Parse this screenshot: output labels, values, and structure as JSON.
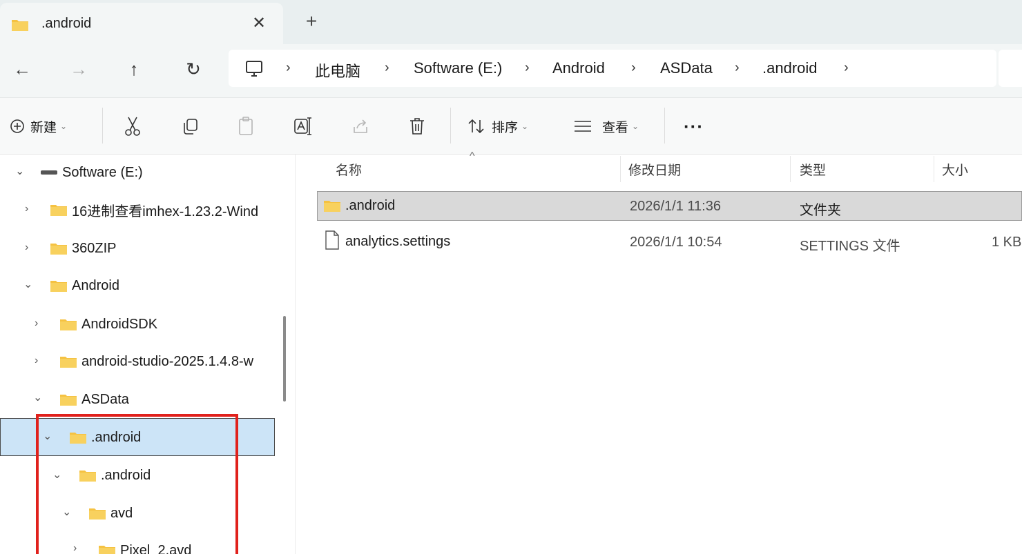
{
  "tab": {
    "title": ".android",
    "close": "✕",
    "new": "+"
  },
  "nav": {
    "back": "←",
    "forward": "→",
    "up": "↑",
    "refresh": "↻"
  },
  "breadcrumb": [
    "此电脑",
    "Software (E:)",
    "Android",
    "ASData",
    ".android"
  ],
  "breadcrumb_sep": "›",
  "toolbar": {
    "new_label": "新建",
    "sort_label": "排序",
    "view_label": "查看",
    "more": "···"
  },
  "sidebar": {
    "items": [
      {
        "label": "Software (E:)",
        "arrow": "⌄",
        "icon": "drive-icon"
      },
      {
        "label": "16进制查看imhex-1.23.2-Wind",
        "arrow": "›",
        "icon": "folder-icon"
      },
      {
        "label": "360ZIP",
        "arrow": "›",
        "icon": "folder-icon"
      },
      {
        "label": "Android",
        "arrow": "⌄",
        "icon": "folder-icon"
      },
      {
        "label": "AndroidSDK",
        "arrow": "›",
        "icon": "folder-icon"
      },
      {
        "label": "android-studio-2025.1.4.8-w",
        "arrow": "›",
        "icon": "folder-icon"
      },
      {
        "label": "ASData",
        "arrow": "⌄",
        "icon": "folder-icon"
      },
      {
        "label": ".android",
        "arrow": "⌄",
        "icon": "folder-icon",
        "selected": true
      },
      {
        "label": ".android",
        "arrow": "⌄",
        "icon": "folder-icon"
      },
      {
        "label": "avd",
        "arrow": "⌄",
        "icon": "folder-icon"
      },
      {
        "label": "Pixel_2.avd",
        "arrow": "›",
        "icon": "folder-icon"
      }
    ]
  },
  "columns": {
    "name": "名称",
    "modified": "修改日期",
    "type": "类型",
    "size": "大小"
  },
  "files": [
    {
      "name": ".android",
      "modified": "2026/1/1 11:36",
      "type": "文件夹",
      "size": "",
      "icon": "folder-icon",
      "selected": true
    },
    {
      "name": "analytics.settings",
      "modified": "2026/1/1 10:54",
      "type": "SETTINGS 文件",
      "size": "1 KB",
      "icon": "file-icon"
    }
  ],
  "colors": {
    "accent_selected": "#cce4f7",
    "highlight_red": "#e0211c",
    "folder": "#f5c242"
  }
}
